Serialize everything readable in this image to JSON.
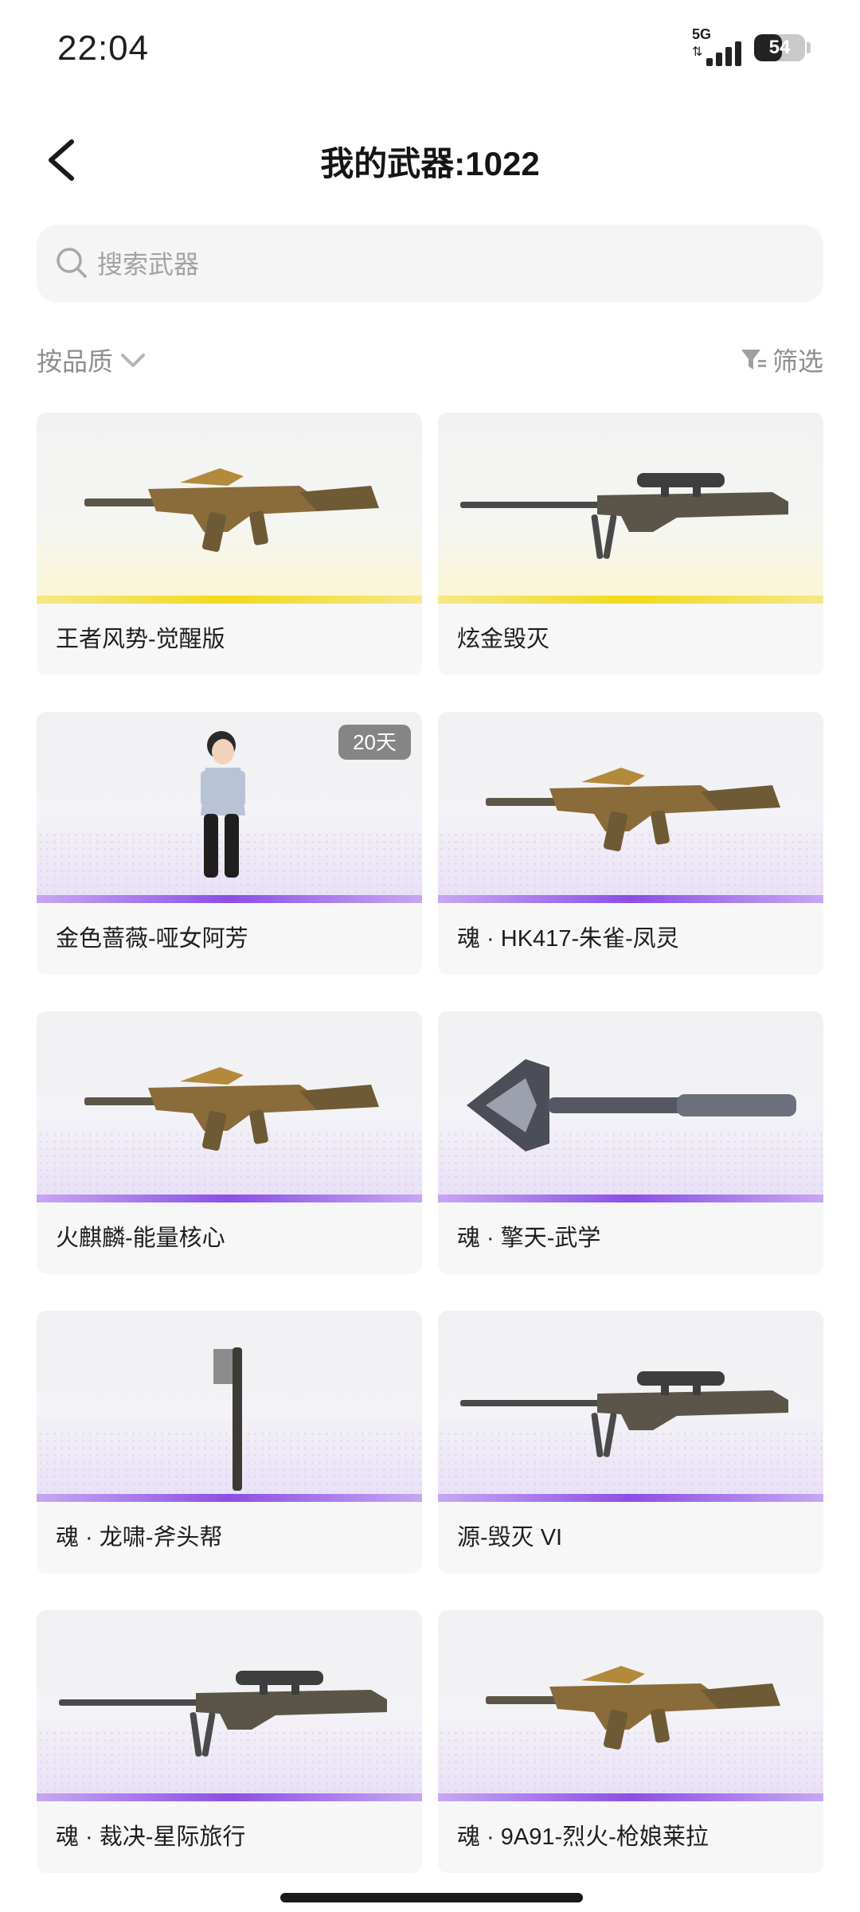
{
  "status_bar": {
    "time": "22:04",
    "network": "5G",
    "battery": "54",
    "battery_level": 0.54
  },
  "header": {
    "title": "我的武器:1022"
  },
  "search": {
    "placeholder": "搜索武器"
  },
  "toolbar": {
    "sort_label": "按品质",
    "filter_label": "筛选"
  },
  "weapons": [
    {
      "name": "王者风势-觉醒版",
      "tier": "gold",
      "art": "assault-rifle"
    },
    {
      "name": "炫金毁灭",
      "tier": "gold",
      "art": "sniper-rifle"
    },
    {
      "name": "金色蔷薇-哑女阿芳",
      "tier": "purple",
      "art": "character",
      "badge": "20天"
    },
    {
      "name": "魂 · HK417-朱雀-凤灵",
      "tier": "purple",
      "art": "assault-rifle"
    },
    {
      "name": "火麒麟-能量核心",
      "tier": "purple",
      "art": "assault-rifle"
    },
    {
      "name": "魂 · 擎天-武学",
      "tier": "purple",
      "art": "melee-spear"
    },
    {
      "name": "魂 · 龙啸-斧头帮",
      "tier": "purple",
      "art": "axe"
    },
    {
      "name": "源-毁灭 VI",
      "tier": "purple",
      "art": "sniper-rifle"
    },
    {
      "name": "魂 · 裁决-星际旅行",
      "tier": "purple",
      "art": "sniper-rifle"
    },
    {
      "name": "魂 · 9A91-烈火-枪娘莱拉",
      "tier": "purple",
      "art": "assault-rifle"
    }
  ]
}
